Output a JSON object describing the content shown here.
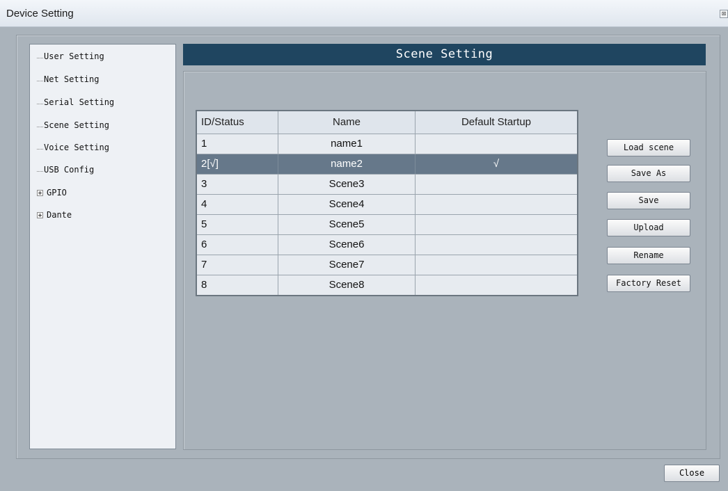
{
  "window": {
    "title": "Device Setting",
    "close_glyph": "⊠"
  },
  "tree": {
    "items": [
      {
        "label": "User Setting"
      },
      {
        "label": "Net Setting"
      },
      {
        "label": "Serial Setting"
      },
      {
        "label": "Scene Setting"
      },
      {
        "label": "Voice Setting"
      },
      {
        "label": "USB Config"
      }
    ],
    "groups": [
      {
        "label": "GPIO"
      },
      {
        "label": "Dante"
      }
    ]
  },
  "panel": {
    "title": "Scene Setting"
  },
  "table": {
    "headers": [
      "ID/Status",
      "Name",
      "Default Startup"
    ],
    "rows": [
      {
        "id": "1",
        "name": "name1",
        "default": ""
      },
      {
        "id": "2[√]",
        "name": "name2",
        "default": "√"
      },
      {
        "id": "3",
        "name": "Scene3",
        "default": ""
      },
      {
        "id": "4",
        "name": "Scene4",
        "default": ""
      },
      {
        "id": "5",
        "name": "Scene5",
        "default": ""
      },
      {
        "id": "6",
        "name": "Scene6",
        "default": ""
      },
      {
        "id": "7",
        "name": "Scene7",
        "default": ""
      },
      {
        "id": "8",
        "name": "Scene8",
        "default": ""
      }
    ],
    "selected_index": 1
  },
  "buttons": {
    "load_scene": "Load scene",
    "save_as": "Save As",
    "save": "Save",
    "upload": "Upload",
    "rename": "Rename",
    "factory_reset": "Factory Reset",
    "close": "Close"
  },
  "colors": {
    "header_bg": "#1f4560",
    "selected_row": "#66788a",
    "window_bg": "#aab3bb"
  }
}
